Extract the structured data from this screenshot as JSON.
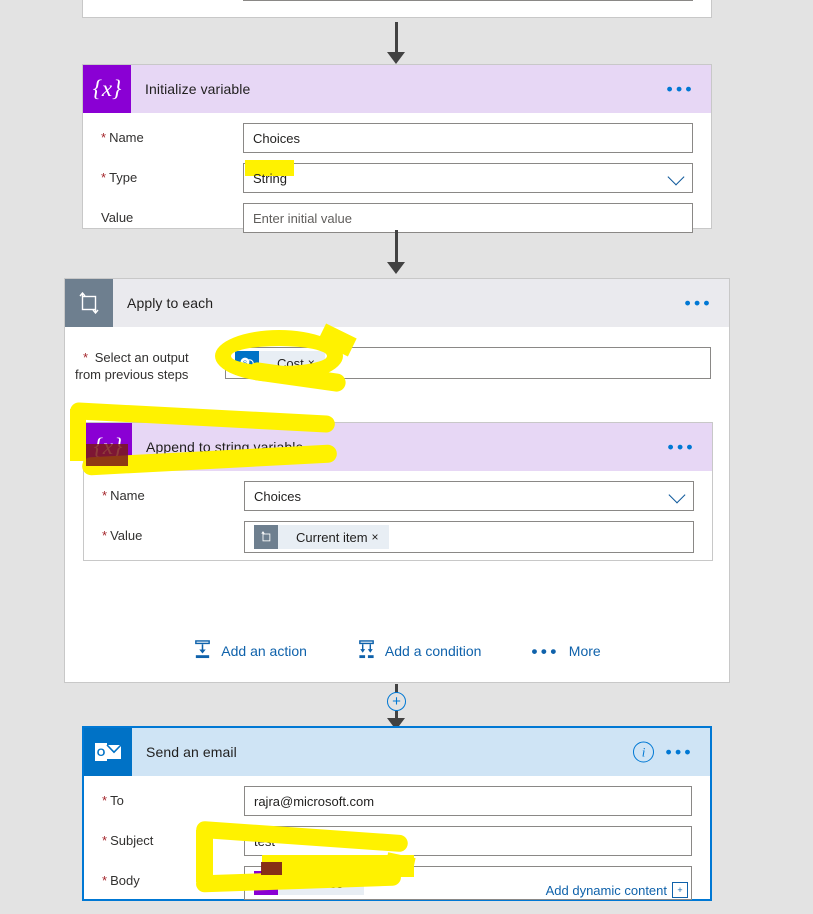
{
  "app": {
    "background_color": "#e3e3e3",
    "accent_color": "#0078d4",
    "highlight_color": "#fff200"
  },
  "cards": {
    "initialize_variable": {
      "title": "Initialize variable",
      "icon": "variable-braces-icon",
      "icon_glyph": "{x}",
      "header_color": "#e7d7f5",
      "icon_color": "#8a00d4",
      "menu_label": "•••",
      "fields": [
        {
          "label": "Name",
          "required": true,
          "value": "Choices",
          "is_placeholder": false,
          "has_dropdown": false
        },
        {
          "label": "Type",
          "required": true,
          "value": "String",
          "is_placeholder": false,
          "has_dropdown": true,
          "highlighted": true
        },
        {
          "label": "Value",
          "required": false,
          "value": "Enter initial value",
          "is_placeholder": true,
          "has_dropdown": false
        }
      ]
    },
    "apply_to_each": {
      "title": "Apply to each",
      "icon": "loop-repeat-icon",
      "header_color": "#eaeaee",
      "icon_color": "#6e7f8f",
      "menu_label": "•••",
      "select_field": {
        "label_line1": "Select an output",
        "label_line2": "from previous steps",
        "required": true,
        "token": {
          "text": "Cost",
          "icon": "sharepoint-token-icon",
          "icon_glyph": "s",
          "remove_label": "×"
        }
      },
      "footer_actions": [
        {
          "label": "Add an action",
          "icon": "add-action-icon"
        },
        {
          "label": "Add a condition",
          "icon": "add-condition-icon"
        },
        {
          "label": "More",
          "icon": "more-dots-icon"
        }
      ]
    },
    "append_to_string": {
      "title": "Append to string variable",
      "icon": "variable-braces-icon",
      "icon_glyph": "{x}",
      "header_color": "#e7d7f5",
      "icon_color": "#8a00d4",
      "menu_label": "•••",
      "fields": [
        {
          "label": "Name",
          "required": true,
          "value": "Choices",
          "has_dropdown": true
        },
        {
          "label": "Value",
          "required": true,
          "token": {
            "text": "Current item",
            "icon": "loop-token-icon",
            "remove_label": "×"
          }
        }
      ]
    },
    "send_an_email": {
      "title": "Send an email",
      "icon": "outlook-icon",
      "header_color": "#cfe4f5",
      "icon_color": "#0072c6",
      "info_label": "i",
      "menu_label": "•••",
      "fields": [
        {
          "label": "To",
          "required": true,
          "value": "rajra@microsoft.com"
        },
        {
          "label": "Subject",
          "required": true,
          "value": "test"
        },
        {
          "label": "Body",
          "required": true,
          "token": {
            "text": "Choices",
            "icon": "variable-token-icon",
            "icon_glyph": "{x}",
            "remove_label": "×"
          }
        }
      ],
      "dynamic_content_label": "Add dynamic content",
      "dynamic_content_badge": "+"
    }
  },
  "connectors": {
    "add_step_label": "+"
  }
}
